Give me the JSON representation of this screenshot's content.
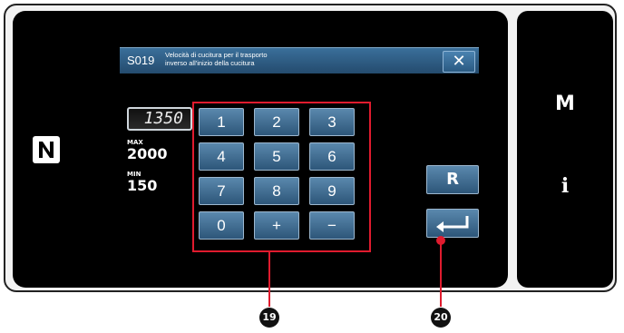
{
  "dialog": {
    "code": "S019",
    "description_line1": "Velocità di cucitura per il trasporto",
    "description_line2": "inverso all'inizio della cucitura",
    "close_glyph": "✕"
  },
  "value_display": {
    "value": "1350"
  },
  "limits": {
    "max_label": "MAX",
    "max_value": "2000",
    "min_label": "MIN",
    "min_value": "150"
  },
  "keypad": [
    "1",
    "2",
    "3",
    "4",
    "5",
    "6",
    "7",
    "8",
    "9",
    "0",
    "+",
    "−"
  ],
  "side_panel": {
    "reset_label": "R",
    "enter_icon": "enter-arrow-icon"
  },
  "right_panel": {
    "m_label": "M",
    "info_label": "i"
  },
  "nfc_icon": "nfc-icon",
  "callouts": {
    "keypad": "19",
    "enter": "20"
  }
}
